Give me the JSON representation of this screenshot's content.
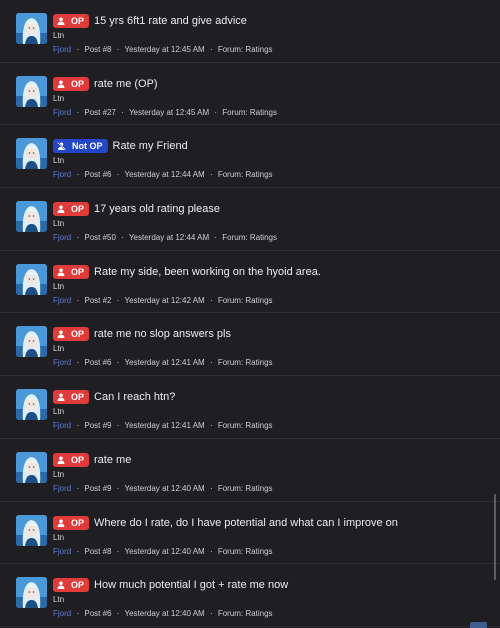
{
  "posts": [
    {
      "badge": "OP",
      "title": "15 yrs 6ft1 rate and give advice",
      "author": "Ltn",
      "poster": "Fjord",
      "post": "Post #8",
      "time": "Yesterday at 12:45 AM",
      "forum": "Forum: Ratings"
    },
    {
      "badge": "OP",
      "title": "rate me (OP)",
      "author": "Ltn",
      "poster": "Fjord",
      "post": "Post #27",
      "time": "Yesterday at 12:45 AM",
      "forum": "Forum: Ratings"
    },
    {
      "badge": "Not OP",
      "title": "Rate my Friend",
      "author": "Ltn",
      "poster": "Fjord",
      "post": "Post #6",
      "time": "Yesterday at 12:44 AM",
      "forum": "Forum: Ratings"
    },
    {
      "badge": "OP",
      "title": "17 years old rating please",
      "author": "Ltn",
      "poster": "Fjord",
      "post": "Post #50",
      "time": "Yesterday at 12:44 AM",
      "forum": "Forum: Ratings"
    },
    {
      "badge": "OP",
      "title": "Rate my side, been working on the hyoid area.",
      "author": "Ltn",
      "poster": "Fjord",
      "post": "Post #2",
      "time": "Yesterday at 12:42 AM",
      "forum": "Forum: Ratings"
    },
    {
      "badge": "OP",
      "title": "rate me no slop answers pls",
      "author": "Ltn",
      "poster": "Fjord",
      "post": "Post #6",
      "time": "Yesterday at 12:41 AM",
      "forum": "Forum: Ratings"
    },
    {
      "badge": "OP",
      "title": "Can I reach htn?",
      "author": "Ltn",
      "poster": "Fjord",
      "post": "Post #9",
      "time": "Yesterday at 12:41 AM",
      "forum": "Forum: Ratings"
    },
    {
      "badge": "OP",
      "title": "rate me",
      "author": "Ltn",
      "poster": "Fjord",
      "post": "Post #9",
      "time": "Yesterday at 12:40 AM",
      "forum": "Forum: Ratings"
    },
    {
      "badge": "OP",
      "title": "Where do I rate, do I have potential and what can I improve on",
      "author": "Ltn",
      "poster": "Fjord",
      "post": "Post #8",
      "time": "Yesterday at 12:40 AM",
      "forum": "Forum: Ratings"
    },
    {
      "badge": "OP",
      "title": "How much potential I got + rate me now",
      "author": "Ltn",
      "poster": "Fjord",
      "post": "Post #6",
      "time": "Yesterday at 12:40 AM",
      "forum": "Forum: Ratings"
    }
  ],
  "meta_separator": "·",
  "icons": {
    "op_badge": "user-icon",
    "notop_badge": "user-slash-icon",
    "avatar": "avatar-image"
  },
  "colors": {
    "op_badge": "#e03b3b",
    "notop_badge": "#2446c7",
    "poster_link": "#5b78d6",
    "background": "#1f1f23"
  }
}
